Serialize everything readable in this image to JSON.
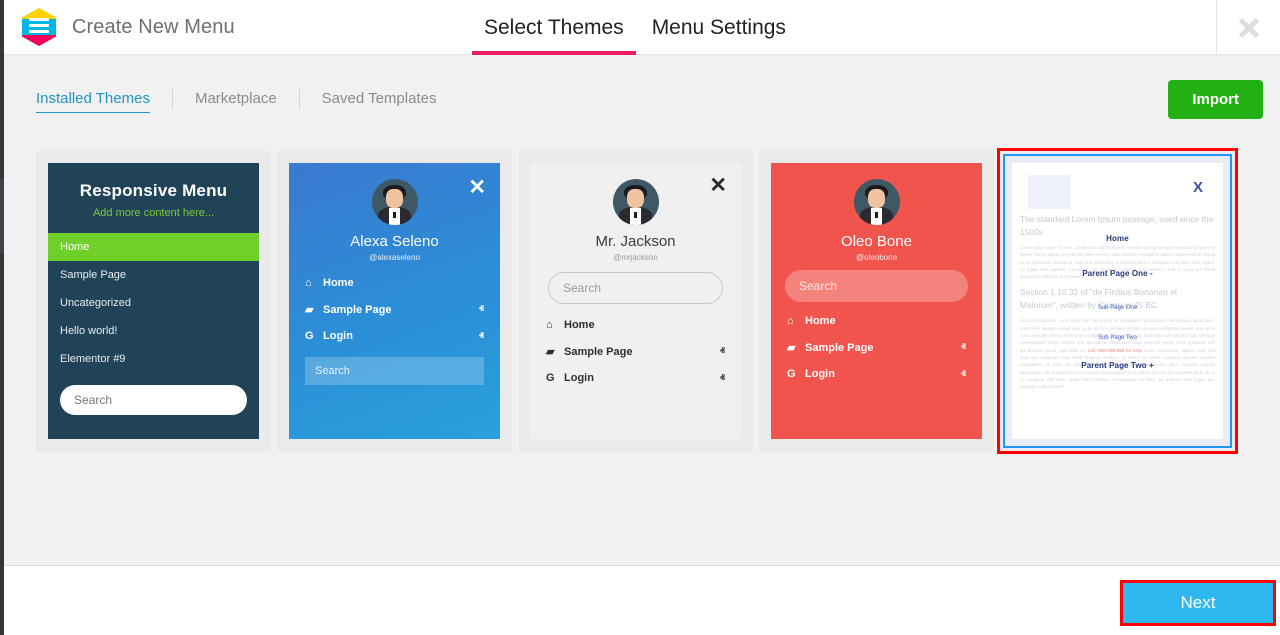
{
  "header": {
    "logo_icon": "menu-hexagon-logo",
    "title": "Create New Menu",
    "tabs": [
      {
        "label": "Select Themes",
        "active": true
      },
      {
        "label": "Menu Settings",
        "active": false
      }
    ],
    "close_icon": "close-icon"
  },
  "subnav": {
    "items": [
      {
        "label": "Installed Themes",
        "active": true
      },
      {
        "label": "Marketplace",
        "active": false
      },
      {
        "label": "Saved Templates",
        "active": false
      }
    ],
    "import_label": "Import"
  },
  "colors": {
    "accent_pink": "#e91e63",
    "link_blue": "#2196c4",
    "import_green": "#22b014",
    "next_blue": "#2fb7ef",
    "highlight_red": "#ff0000",
    "selected_border_blue": "#2196f3"
  },
  "themes": [
    {
      "id": "responsive-menu-dark",
      "selected": false,
      "style": "dark",
      "title": "Responsive Menu",
      "subtitle": "Add more content here...",
      "menu": [
        {
          "label": "Home",
          "active": true
        },
        {
          "label": "Sample Page",
          "active": false
        },
        {
          "label": "Uncategorized",
          "active": false
        },
        {
          "label": "Hello world!",
          "active": false
        },
        {
          "label": "Elementor #9",
          "active": false
        }
      ],
      "search_placeholder": "Search"
    },
    {
      "id": "alexa-seleno-blue",
      "selected": false,
      "style": "blue",
      "close_icon": "close-icon",
      "avatar_icon": "user-avatar",
      "name": "Alexa Seleno",
      "username": "@alexaseleno",
      "menu": [
        {
          "icon": "home-icon",
          "glyph": "⌂",
          "label": "Home",
          "caret": ""
        },
        {
          "icon": "folder-icon",
          "glyph": "▰",
          "label": "Sample Page",
          "caret": "ⱏ"
        },
        {
          "icon": "google-icon",
          "glyph": "G",
          "label": "Login",
          "caret": "ⱏ"
        }
      ],
      "search_placeholder": "Search",
      "search_position": "bottom"
    },
    {
      "id": "mr-jackson-light",
      "selected": false,
      "style": "light",
      "close_icon": "close-icon",
      "avatar_icon": "user-avatar",
      "name": "Mr. Jackson",
      "username": "@mrjackson",
      "menu": [
        {
          "icon": "home-icon",
          "glyph": "⌂",
          "label": "Home",
          "caret": ""
        },
        {
          "icon": "folder-icon",
          "glyph": "▰",
          "label": "Sample Page",
          "caret": "ⱏ"
        },
        {
          "icon": "google-icon",
          "glyph": "G",
          "label": "Login",
          "caret": "ⱏ"
        }
      ],
      "search_placeholder": "Search",
      "search_position": "top"
    },
    {
      "id": "oleo-bone-red",
      "selected": false,
      "style": "red",
      "close_icon": "close-icon",
      "avatar_icon": "user-avatar",
      "name": "Oleo Bone",
      "username": "@oleobone",
      "menu": [
        {
          "icon": "home-icon",
          "glyph": "⌂",
          "label": "Home",
          "caret": ""
        },
        {
          "icon": "folder-icon",
          "glyph": "▰",
          "label": "Sample Page",
          "caret": "ⱏ"
        },
        {
          "icon": "google-icon",
          "glyph": "G",
          "label": "Login",
          "caret": "ⱏ"
        }
      ],
      "search_placeholder": "Search",
      "search_position": "top"
    },
    {
      "id": "page-preview-selected",
      "selected": true,
      "style": "preview",
      "close_icon": "close-icon",
      "close_label": "X",
      "page": {
        "heading_1": "The standard Lorem Ipsum passage, used since the 1500s",
        "paragraph_1": "Lorem ipsum dolor sit amet, consectetur adipiscing elit, sed do eiusmod tempor incididunt ut labore et dolore magna aliqua. Ut enim ad minim veniam, quis nostrud exercitation ullamco laboris nisi ut aliquip ex ea commodo consequat. Duis aute irure dolor in reprehenderit in voluptate velit esse cillum dolore eu fugiat nulla pariatur. Excepteur sint occaecat cupidatat non proident, sunt in culpa qui officia deserunt mollit anim id est laborum.",
        "heading_2": "Section 1.10.32 of \"de Finibus Bonorum et Malorum\", written by Cicero in 45 BC",
        "paragraph_2_before": "Sed ut perspiciatis, unde omnis iste natus error sit voluptatem accusantium doloremque laudantium, totam rem aperiam eaque ipsa, quae ab illo inventore veritatis et quasi architecto beatae vitae dicta sunt, explicabo. Nemo enim ipsam voluptatem, quia voluptas sit, aspernatur aut odit aut fugit, sed quia consequuntur magni dolores eos, qui ratione voluptatem sequi nesciunt, neque porro quisquam est, qui dolorem ipsum, quia dolor sit, ",
        "paragraph_2_phone": "Call 0500-888-888 for help",
        "paragraph_2_after": " amet, consectetur, adipisci velit, sed quia non numquam eius modi tempora incidunt, ut labore et dolore magnam aliquam quaerat voluptatem. Ut enim ad minima veniam, quis nostrum exercitationem ullam corporis suscipit laboriosam, nisi ut aliquid ex ea commodi consequatur? Quis autem vel eum iure reprehenderit, qui in ea voluptate velit esse, quam nihil molestiae consequatur, vel illum, qui dolorem eum fugiat, quo voluptas nulla pariatur?"
      },
      "menu_overlay": [
        {
          "label": "Home",
          "level": "parent"
        },
        {
          "label": "Parent Page One -",
          "level": "parent"
        },
        {
          "label": "Sub Page One",
          "level": "sub"
        },
        {
          "label": "Sub Page Two",
          "level": "sub"
        },
        {
          "label": "Parent Page Two +",
          "level": "parent"
        }
      ]
    }
  ],
  "footer": {
    "next_label": "Next"
  }
}
